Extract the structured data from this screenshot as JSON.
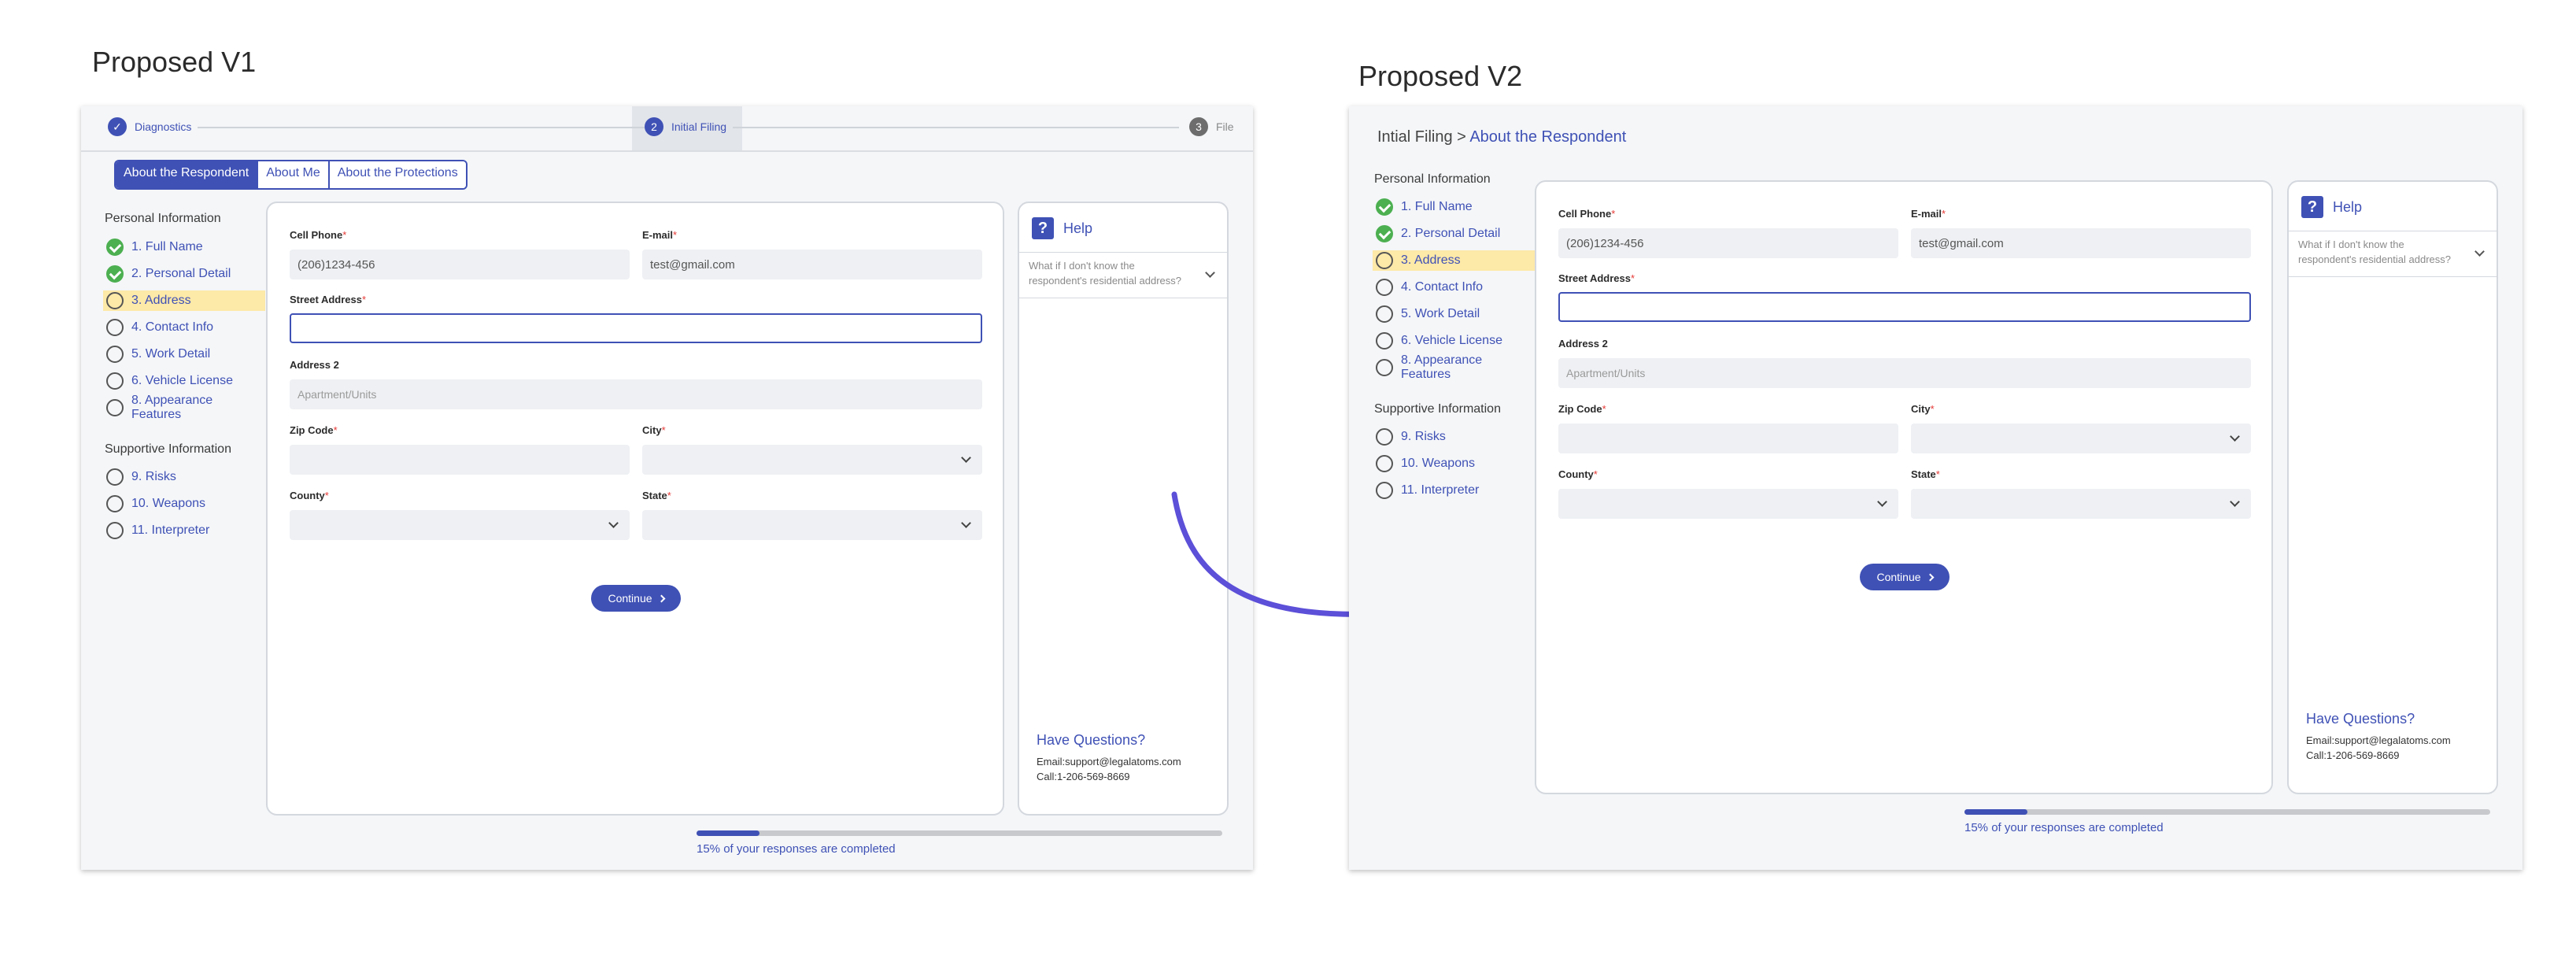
{
  "v1": {
    "title": "Proposed V1"
  },
  "v2": {
    "title": "Proposed V2",
    "breadcrumb_root": "Intial Filing",
    "breadcrumb_sep": ">",
    "breadcrumb_current": "About the Respondent"
  },
  "stepper": [
    {
      "label": "Diagnostics",
      "mark": "✓"
    },
    {
      "label": "Initial Filing",
      "mark": "2"
    },
    {
      "label": "File",
      "mark": "3"
    }
  ],
  "tabs": [
    "About the Respondent",
    "About Me",
    "About the Protections"
  ],
  "nav": {
    "personal_heading": "Personal Information",
    "personal": [
      "1. Full Name",
      "2. Personal Detail",
      "3. Address",
      "4. Contact Info",
      "5. Work Detail",
      "6. Vehicle License",
      "8. Appearance Features"
    ],
    "supportive_heading": "Supportive Information",
    "supportive": [
      "9. Risks",
      "10. Weapons",
      "11. Interpreter"
    ]
  },
  "form": {
    "cell_phone_label": "Cell Phone",
    "cell_phone_value": "(206)1234-456",
    "email_label": "E-mail",
    "email_value": "test@gmail.com",
    "street_label": "Street Address",
    "address2_label": "Address 2",
    "address2_placeholder": "Apartment/Units",
    "zip_label": "Zip Code",
    "city_label": "City",
    "county_label": "County",
    "state_label": "State",
    "required_mark": "*",
    "continue_label": "Continue"
  },
  "help": {
    "icon": "?",
    "title": "Help",
    "question": "What if I don't know the respondent's residential address?",
    "have_questions": "Have Questions?",
    "email": "Email:support@legalatoms.com",
    "call": "Call:1-206-569-8669"
  },
  "progress": {
    "fraction": 0.12,
    "text": "15% of your responses are completed"
  },
  "colors": {
    "accent": "#3f51b5",
    "arrow": "#5c4fd8",
    "done": "#4caf50",
    "current_highlight": "#fde9a8"
  }
}
